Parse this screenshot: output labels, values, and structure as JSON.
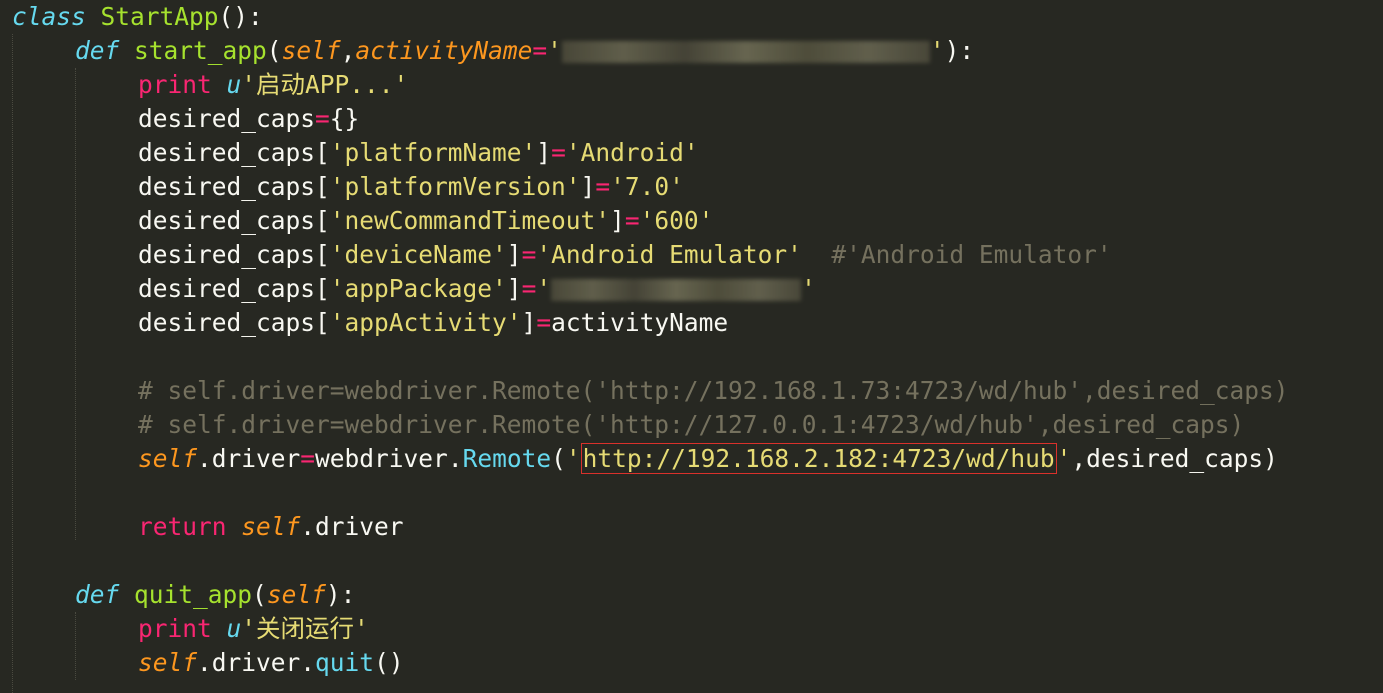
{
  "code": {
    "class_kw": "class",
    "class_name": "StartApp",
    "class_tail": "():",
    "def_kw": "def",
    "start_fn": "start_app",
    "self_kw": "self",
    "param_activity": "activityName",
    "print_kw": "print",
    "u_prefix": "u",
    "print_msg_start": "'启动APP...'",
    "desired_caps": "desired_caps",
    "empty_dict": "{}",
    "key_platformName": "'platformName'",
    "val_platformName": "'Android'",
    "key_platformVersion": "'platformVersion'",
    "val_platformVersion": "'7.0'",
    "key_newCommandTimeout": "'newCommandTimeout'",
    "val_newCommandTimeout": "'600'",
    "key_deviceName": "'deviceName'",
    "val_deviceName": "'Android Emulator'",
    "comment_deviceName": "#'Android Emulator'",
    "key_appPackage": "'appPackage'",
    "key_appActivity": "'appActivity'",
    "val_appActivity": "activityName",
    "comment_remote_1": "# self.driver=webdriver.Remote('http://192.168.1.73:4723/wd/hub',desired_caps)",
    "comment_remote_2": "# self.driver=webdriver.Remote('http://127.0.0.1:4723/wd/hub',desired_caps)",
    "driver_attr": ".driver",
    "webdriver": "webdriver",
    "remote_method": "Remote",
    "remote_url": "http://192.168.2.182:4723/wd/hub",
    "remote_args_tail": ",desired_caps)",
    "return_kw": "return",
    "quit_fn": "quit_app",
    "print_msg_quit": "'关闭运行'",
    "quit_method": "quit"
  }
}
